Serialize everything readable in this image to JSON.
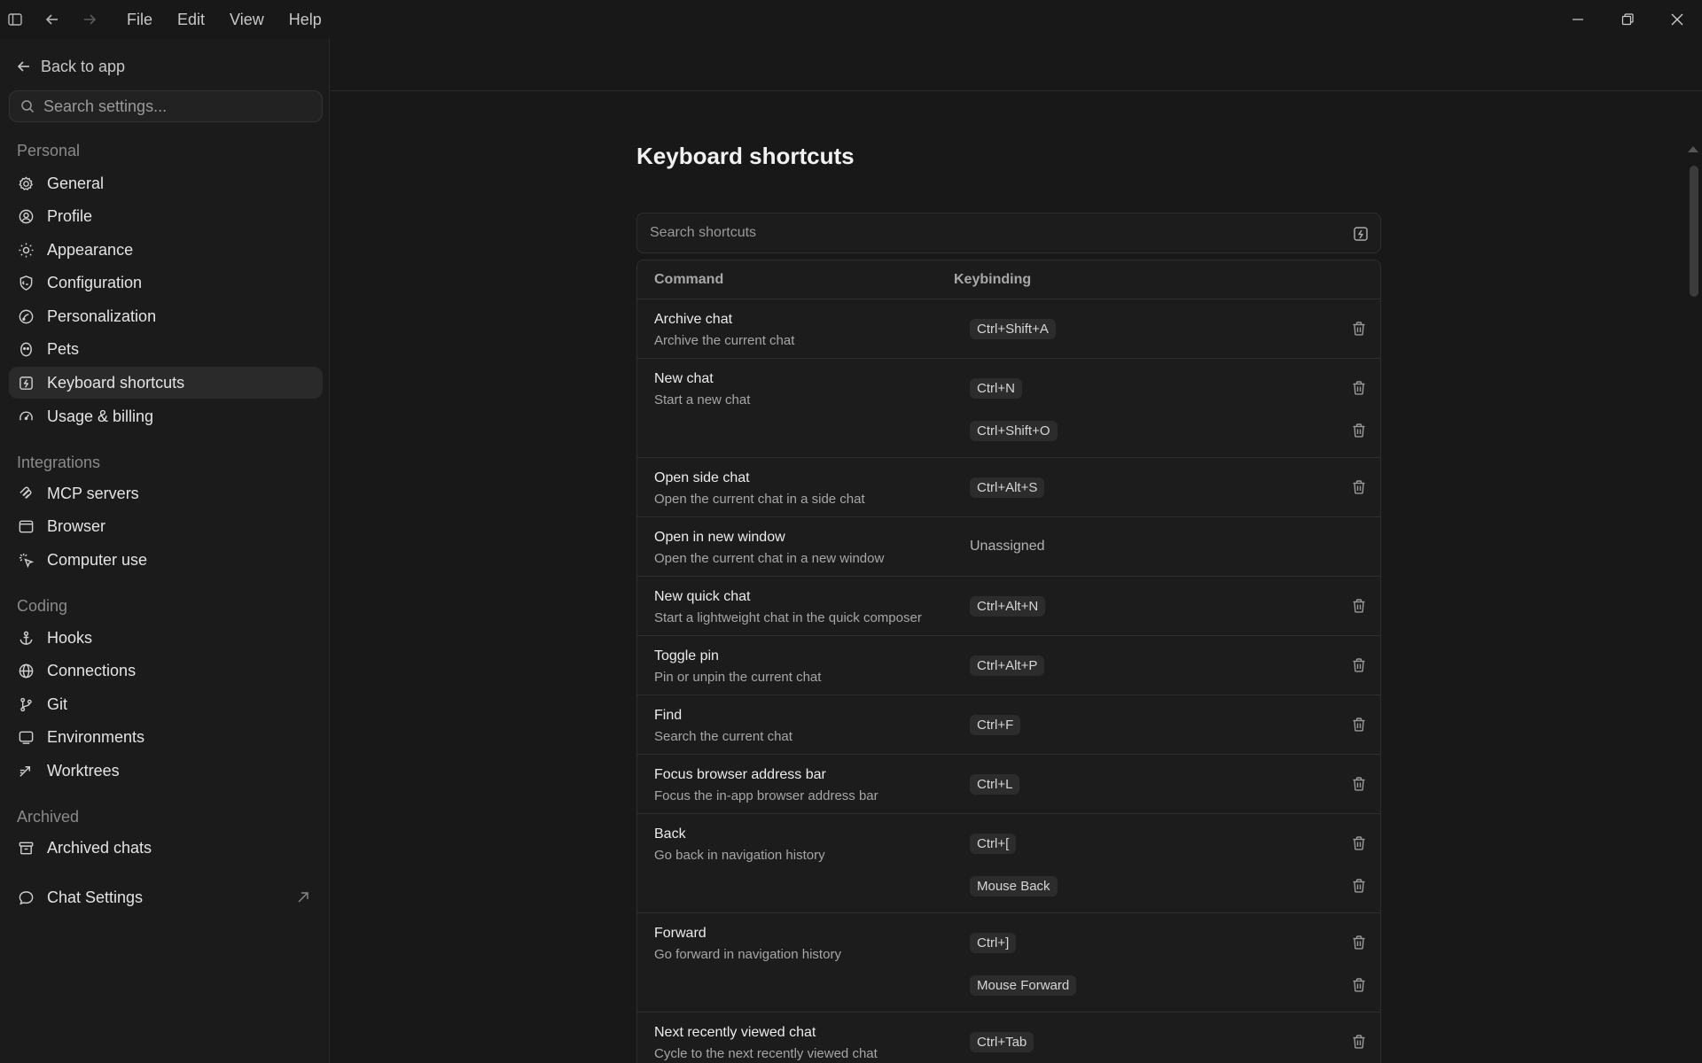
{
  "titlebar": {
    "menu": [
      "File",
      "Edit",
      "View",
      "Help"
    ]
  },
  "sidebar": {
    "back_label": "Back to app",
    "search_placeholder": "Search settings...",
    "sections": {
      "personal": "Personal",
      "integrations": "Integrations",
      "coding": "Coding",
      "archived": "Archived"
    },
    "items": {
      "general": "General",
      "profile": "Profile",
      "appearance": "Appearance",
      "configuration": "Configuration",
      "personalization": "Personalization",
      "pets": "Pets",
      "keyboard_shortcuts": "Keyboard shortcuts",
      "usage_billing": "Usage & billing",
      "mcp_servers": "MCP servers",
      "browser": "Browser",
      "computer_use": "Computer use",
      "hooks": "Hooks",
      "connections": "Connections",
      "git": "Git",
      "environments": "Environments",
      "worktrees": "Worktrees",
      "archived_chats": "Archived chats",
      "chat_settings": "Chat Settings"
    }
  },
  "main": {
    "title": "Keyboard shortcuts",
    "search_placeholder": "Search shortcuts",
    "columns": {
      "command": "Command",
      "keybinding": "Keybinding"
    },
    "rows": [
      {
        "name": "Archive chat",
        "desc": "Archive the current chat",
        "keys": [
          "Ctrl+Shift+A"
        ]
      },
      {
        "name": "New chat",
        "desc": "Start a new chat",
        "keys": [
          "Ctrl+N",
          "Ctrl+Shift+O"
        ]
      },
      {
        "name": "Open side chat",
        "desc": "Open the current chat in a side chat",
        "keys": [
          "Ctrl+Alt+S"
        ]
      },
      {
        "name": "Open in new window",
        "desc": "Open the current chat in a new window",
        "keys": [],
        "unassigned": "Unassigned"
      },
      {
        "name": "New quick chat",
        "desc": "Start a lightweight chat in the quick composer",
        "keys": [
          "Ctrl+Alt+N"
        ]
      },
      {
        "name": "Toggle pin",
        "desc": "Pin or unpin the current chat",
        "keys": [
          "Ctrl+Alt+P"
        ]
      },
      {
        "name": "Find",
        "desc": "Search the current chat",
        "keys": [
          "Ctrl+F"
        ]
      },
      {
        "name": "Focus browser address bar",
        "desc": "Focus the in-app browser address bar",
        "keys": [
          "Ctrl+L"
        ]
      },
      {
        "name": "Back",
        "desc": "Go back in navigation history",
        "keys": [
          "Ctrl+[",
          "Mouse Back"
        ]
      },
      {
        "name": "Forward",
        "desc": "Go forward in navigation history",
        "keys": [
          "Ctrl+]",
          "Mouse Forward"
        ]
      },
      {
        "name": "Next recently viewed chat",
        "desc": "Cycle to the next recently viewed chat",
        "keys": [
          "Ctrl+Tab"
        ]
      }
    ]
  }
}
